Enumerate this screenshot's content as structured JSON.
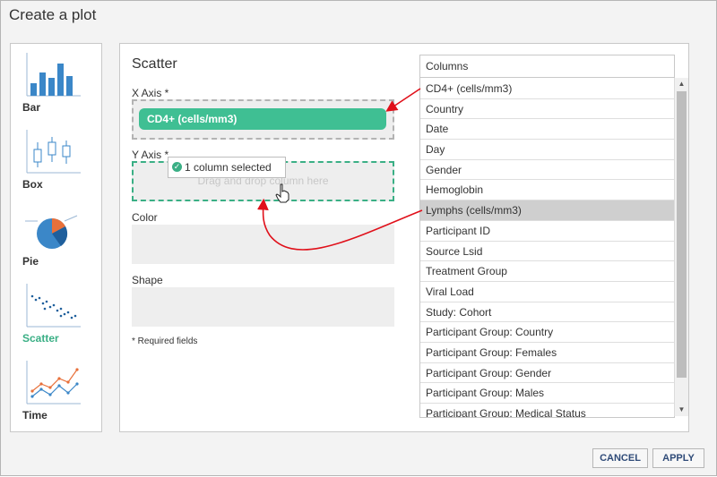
{
  "dialog": {
    "title": "Create a plot"
  },
  "chart_types": [
    {
      "label": "Bar",
      "icon": "bar-chart-icon"
    },
    {
      "label": "Box",
      "icon": "box-plot-icon"
    },
    {
      "label": "Pie",
      "icon": "pie-chart-icon"
    },
    {
      "label": "Scatter",
      "icon": "scatter-plot-icon",
      "active": true
    },
    {
      "label": "Time",
      "icon": "time-chart-icon"
    }
  ],
  "config": {
    "plot_type": "Scatter",
    "x_axis_label": "X Axis *",
    "x_axis_value": "CD4+ (cells/mm3)",
    "y_axis_label": "Y Axis *",
    "y_axis_placeholder": "Drag and drop column here",
    "color_label": "Color",
    "shape_label": "Shape",
    "required_note": "* Required fields"
  },
  "tooltip": {
    "text": "1 column selected"
  },
  "columns": {
    "header": "Columns",
    "items": [
      "CD4+ (cells/mm3)",
      "Country",
      "Date",
      "Day",
      "Gender",
      "Hemoglobin",
      "Lymphs (cells/mm3)",
      "Participant ID",
      "Source Lsid",
      "Treatment Group",
      "Viral Load",
      "Study: Cohort",
      "Participant Group: Country",
      "Participant Group: Females",
      "Participant Group: Gender",
      "Participant Group: Males",
      "Participant Group: Medical Status"
    ],
    "selected": "Lymphs (cells/mm3)"
  },
  "buttons": {
    "cancel": "CANCEL",
    "apply": "APPLY"
  },
  "colors": {
    "accent": "#3aaf85",
    "arrow": "#e0101a",
    "button_text": "#2f4b78"
  }
}
